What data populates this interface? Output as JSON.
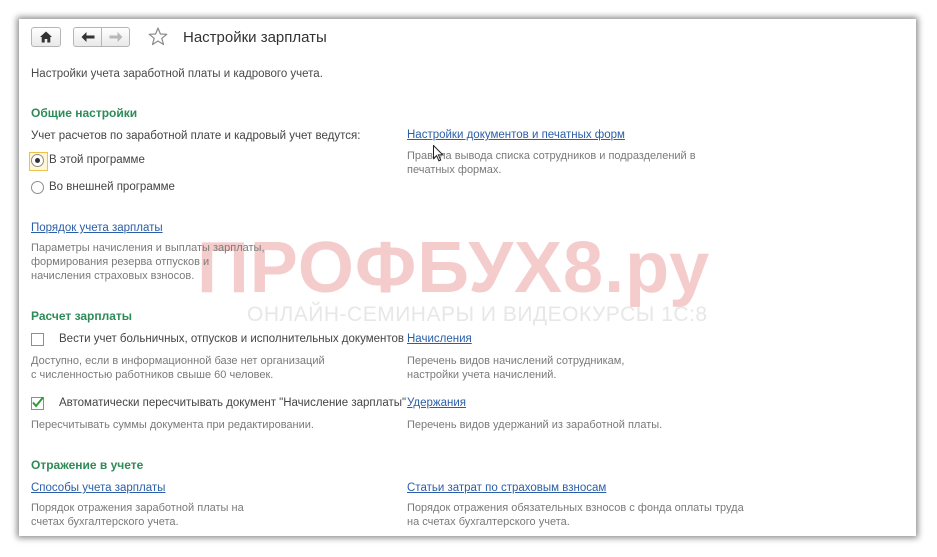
{
  "toolbar": {
    "title": "Настройки зарплаты"
  },
  "page": {
    "description": "Настройки учета заработной платы и кадрового учета."
  },
  "general": {
    "heading": "Общие настройки",
    "accounting_question": "Учет расчетов по заработной плате и кадровый учет ведутся:",
    "options": [
      {
        "label": "В этой программе",
        "selected": true
      },
      {
        "label": "Во внешней программе",
        "selected": false
      }
    ],
    "docs_link": "Настройки документов и печатных форм",
    "docs_hint": "Правила вывода списка сотрудников и подразделений в печатных формах.",
    "payroll_link": "Порядок учета зарплаты",
    "payroll_hint": "Параметры начисления и выплаты зарплаты, формирования резерва отпусков и начисления страховых взносов."
  },
  "calc": {
    "heading": "Расчет зарплаты",
    "sick_leave_label": "Вести учет больничных, отпусков и исполнительных документов",
    "sick_leave_checked": false,
    "sick_leave_hint": "Доступно, если в информационной базе нет организаций с численностью работников свыше 60 человек.",
    "accruals_link": "Начисления",
    "accruals_hint": "Перечень видов начислений сотрудникам, настройки учета начислений.",
    "auto_recalc_label": "Автоматически пересчитывать документ \"Начисление зарплаты\"",
    "auto_recalc_checked": true,
    "auto_recalc_hint": "Пересчитывать суммы документа при редактировании.",
    "deductions_link": "Удержания",
    "deductions_hint": "Перечень видов удержаний из заработной платы."
  },
  "reflection": {
    "heading": "Отражение в учете",
    "methods_link": "Способы учета зарплаты",
    "methods_hint": "Порядок отражения заработной платы на счетах бухгалтерского учета.",
    "cost_items_link": "Статьи затрат по страховым взносам",
    "cost_items_hint": "Порядок отражения обязательных взносов с фонда оплаты труда на счетах бухгалтерского учета."
  },
  "watermark": {
    "brand": "ПРОФБУХ8.ру",
    "tagline": "ОНЛАЙН-СЕМИНАРЫ И ВИДЕОКУРСЫ 1С:8"
  },
  "colors": {
    "section_heading": "#2e8b57",
    "link": "#2b5ea8",
    "watermark": "#f5cccc"
  }
}
